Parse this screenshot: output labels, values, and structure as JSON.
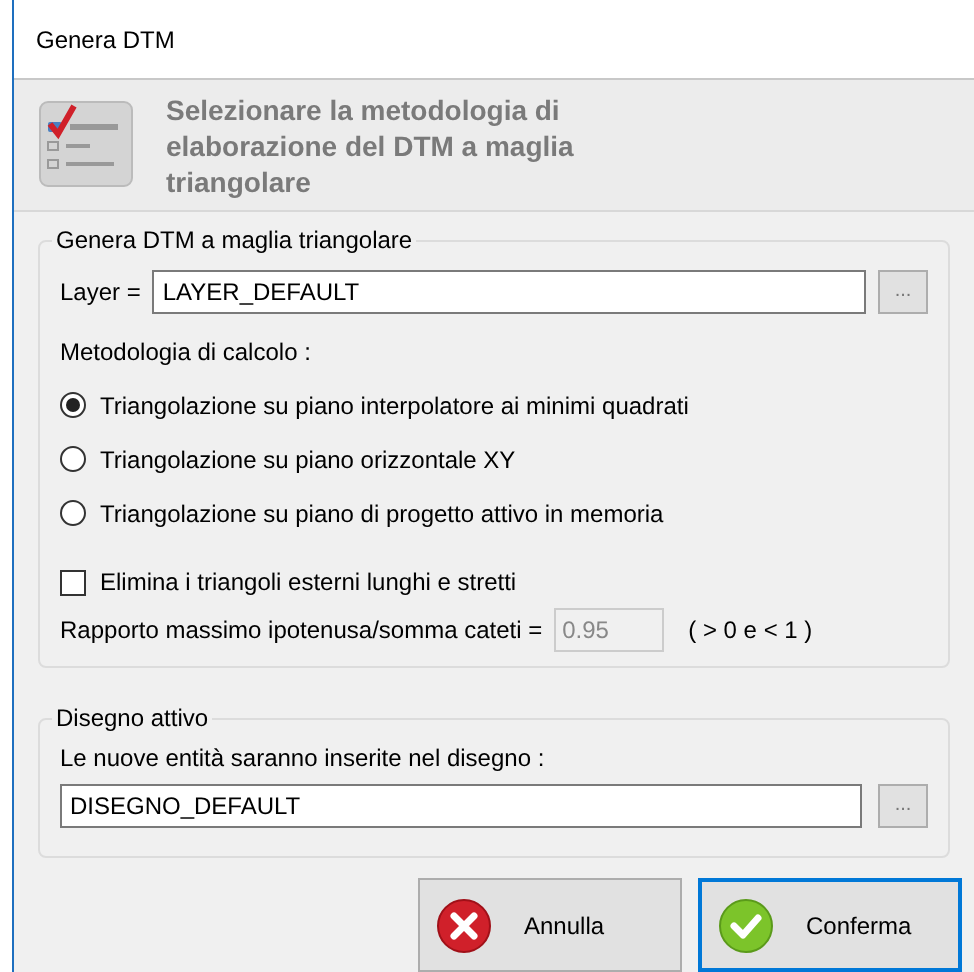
{
  "window": {
    "title": "Genera DTM"
  },
  "header": {
    "text": "Selezionare la metodologia di elaborazione del DTM a maglia triangolare"
  },
  "group_dtm": {
    "title": "Genera DTM a maglia triangolare",
    "layer_label": "Layer =",
    "layer_value": "LAYER_DEFAULT",
    "browse": "...",
    "method_label": "Metodologia di calcolo :",
    "methods": [
      {
        "label": "Triangolazione su piano interpolatore ai minimi quadrati",
        "selected": true
      },
      {
        "label": "Triangolazione su piano orizzontale XY",
        "selected": false
      },
      {
        "label": "Triangolazione su piano di progetto attivo in memoria",
        "selected": false
      }
    ],
    "eliminate": {
      "label": "Elimina i triangoli esterni lunghi e stretti",
      "checked": false
    },
    "ratio_label": "Rapporto massimo ipotenusa/somma cateti =",
    "ratio_value": "0.95",
    "ratio_disabled": true,
    "ratio_hint": "( > 0 e < 1 )"
  },
  "group_drawing": {
    "title": "Disegno attivo",
    "label": "Le nuove entità saranno inserite nel disegno :",
    "value": "DISEGNO_DEFAULT",
    "browse": "..."
  },
  "buttons": [
    {
      "label": "Annulla",
      "kind": "cancel",
      "focused": false
    },
    {
      "label": "Conferma",
      "kind": "confirm",
      "focused": true
    }
  ]
}
